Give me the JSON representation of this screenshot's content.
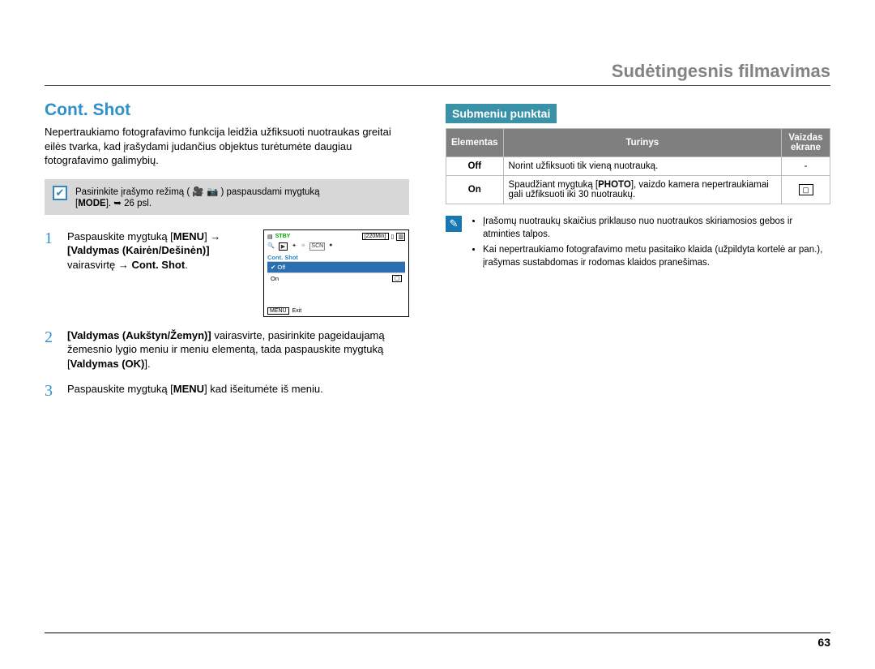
{
  "chapter": "Sudėtingesnis filmavimas",
  "section_title": "Cont. Shot",
  "intro": "Nepertraukiamo fotografavimo funkcija leidžia užfiksuoti nuotraukas greitai eilės tvarka, kad įrašydami judančius objektus turėtumėte daugiau fotografavimo galimybių.",
  "note": {
    "line1_a": "Pasirinkite įrašymo režimą ( ",
    "line1_b": " ) paspausdami mygtuką",
    "line2_a": "[",
    "line2_b": "]. ",
    "line2_c": "26 psl.",
    "mode_label": "MODE",
    "arrow": "➥"
  },
  "steps": [
    {
      "num": "1",
      "seg_a": "Paspauskite mygtuką [",
      "menu_b": "MENU",
      "seg_b": "] → ",
      "bold_b": "[Valdymas (Kairėn/Dešinėn)]",
      "seg_c": " vairasvirtę → ",
      "bold_c": "Cont. Shot",
      "seg_d": "."
    },
    {
      "num": "2",
      "bold_a": "[Valdymas (Aukštyn/Žemyn)]",
      "seg_a": " vairasvirte, pasirinkite pageidaujamą žemesnio lygio meniu ir meniu elementą, tada paspauskite mygtuką [",
      "bold_b": "Valdymas (OK)",
      "seg_b": "]."
    },
    {
      "num": "3",
      "seg_a": "Paspauskite mygtuką [",
      "menu_b": "MENU",
      "seg_b": "] kad išeitumėte iš meniu."
    }
  ],
  "screen": {
    "stby": "STBY",
    "time": "[220Min]",
    "menu_title": "Cont. Shot",
    "off": "Off",
    "on": "On",
    "menu_btn": "MENU",
    "exit": "Exit",
    "check": "✔"
  },
  "submenu_heading": "Submeniu punktai",
  "table": {
    "h1": "Elementas",
    "h2": "Turinys",
    "h3a": "Vaizdas",
    "h3b": "ekrane",
    "rows": [
      {
        "el": "Off",
        "desc": "Norint užfiksuoti tik vieną nuotrauką.",
        "icon": "-"
      },
      {
        "el": "On",
        "desc_a": "Spaudžiant mygtuką [",
        "desc_bold": "PHOTO",
        "desc_b": "], vaizdo kamera nepertraukiamai gali užfiksuoti iki 30 nuotraukų.",
        "icon": "▢"
      }
    ]
  },
  "info": {
    "b1": "Įrašomų nuotraukų skaičius priklauso nuo nuotraukos skiriamosios gebos ir atminties talpos.",
    "b2": "Kai nepertraukiamo fotografavimo metu pasitaiko klaida (užpildyta kortelė ar pan.), įrašymas sustabdomas ir rodomas klaidos pranešimas."
  },
  "page_number": "63",
  "icons": {
    "video": "🎥",
    "camera": "📷"
  }
}
